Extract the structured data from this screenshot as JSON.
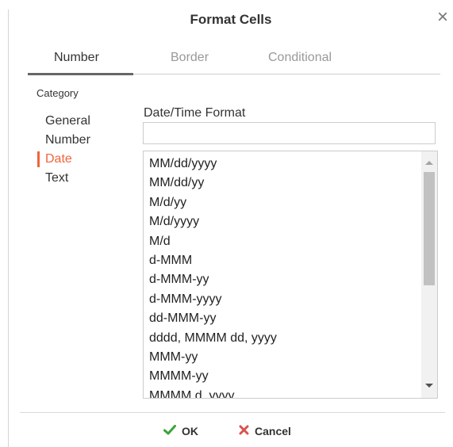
{
  "dialog": {
    "title": "Format Cells",
    "close_glyph": "×"
  },
  "tabs": [
    {
      "label": "Number",
      "active": true
    },
    {
      "label": "Border",
      "active": false
    },
    {
      "label": "Conditional",
      "active": false
    }
  ],
  "category": {
    "label": "Category",
    "items": [
      "General",
      "Number",
      "Date",
      "Text"
    ],
    "selected": "Date"
  },
  "format": {
    "label": "Date/Time Format",
    "input_value": "",
    "options": [
      "MM/dd/yyyy",
      "MM/dd/yy",
      "M/d/yy",
      "M/d/yyyy",
      "M/d",
      "d-MMM",
      "d-MMM-yy",
      "d-MMM-yyyy",
      "dd-MMM-yy",
      "dddd, MMMM dd, yyyy",
      "MMM-yy",
      "MMMM-yy",
      "MMMM d, yyyy"
    ]
  },
  "buttons": {
    "ok_label": "OK",
    "cancel_label": "Cancel"
  },
  "icons": {
    "ok": "check-icon",
    "cancel": "x-icon",
    "close": "close-icon"
  },
  "colors": {
    "accent": "#f0643c",
    "ok_check": "#3aa33a",
    "cancel_x": "#d9534f"
  }
}
